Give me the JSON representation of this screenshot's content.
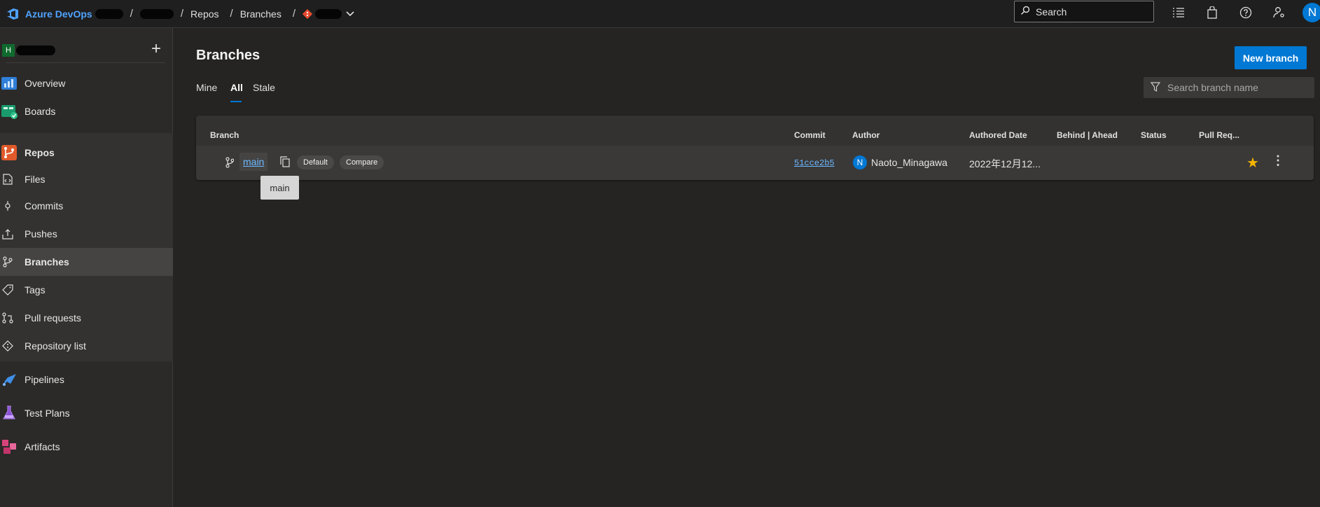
{
  "header": {
    "brand": "Azure DevOps",
    "sep": "/",
    "crumbs": {
      "repos": "Repos",
      "branches": "Branches"
    },
    "search_label": "Search",
    "user_initial": "N"
  },
  "sidebar": {
    "project_initial": "H",
    "items": {
      "overview": "Overview",
      "boards": "Boards",
      "repos": "Repos",
      "files": "Files",
      "commits": "Commits",
      "pushes": "Pushes",
      "branches": "Branches",
      "tags": "Tags",
      "pull_requests": "Pull requests",
      "repository_list": "Repository list",
      "pipelines": "Pipelines",
      "test_plans": "Test Plans",
      "artifacts": "Artifacts"
    }
  },
  "main": {
    "title": "Branches",
    "new_branch": "New branch",
    "tabs": {
      "mine": "Mine",
      "all": "All",
      "stale": "Stale"
    },
    "filter_placeholder": "Search branch name",
    "columns": {
      "branch": "Branch",
      "commit": "Commit",
      "author": "Author",
      "authored_date": "Authored Date",
      "behind_ahead": "Behind | Ahead",
      "status": "Status",
      "pull_request": "Pull Req..."
    },
    "row": {
      "branch": "main",
      "default_badge": "Default",
      "compare_badge": "Compare",
      "commit": "51cce2b5",
      "author_initial": "N",
      "author": "Naoto_Minagawa",
      "date": "2022年12月12..."
    },
    "tooltip": "main"
  },
  "colors": {
    "accent": "#0078d4",
    "link": "#6cb8ff",
    "star": "#f5b400"
  }
}
